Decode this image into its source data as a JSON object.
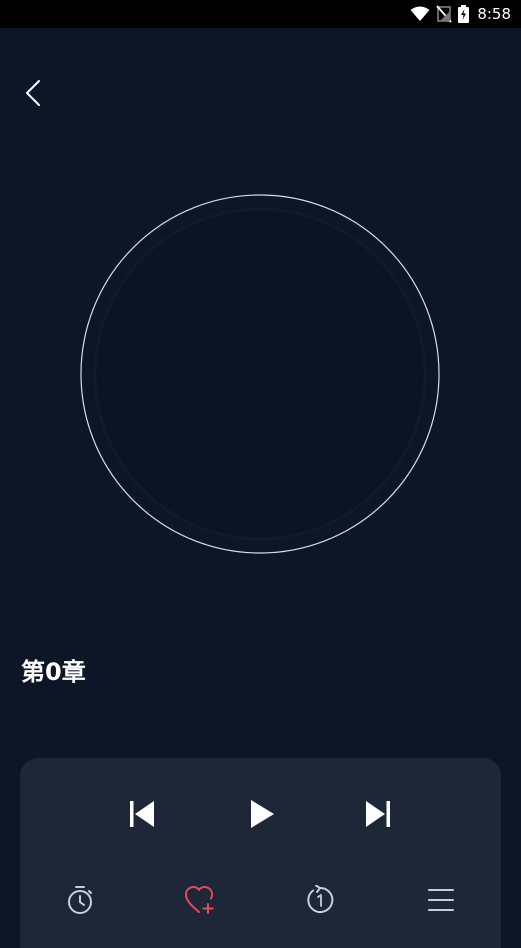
{
  "status_bar": {
    "time": "8:58",
    "icons": [
      "wifi-icon",
      "no-signal-icon",
      "battery-charging-icon"
    ]
  },
  "nav": {
    "back_icon": "chevron-left-icon"
  },
  "player": {
    "chapter_title": "第0章",
    "controls": {
      "previous_icon": "skip-previous-icon",
      "play_icon": "play-icon",
      "next_icon": "skip-next-icon"
    },
    "tools": [
      {
        "name": "timer",
        "icon": "timer-icon"
      },
      {
        "name": "favorite",
        "icon": "heart-add-icon"
      },
      {
        "name": "replay",
        "icon": "replay-1-icon"
      },
      {
        "name": "playlist",
        "icon": "playlist-icon"
      }
    ]
  },
  "colors": {
    "background": "#0c1627",
    "panel": "#1e2738",
    "text": "#ffffff",
    "accent": "#e84a55",
    "icon": "#c9ced8"
  }
}
